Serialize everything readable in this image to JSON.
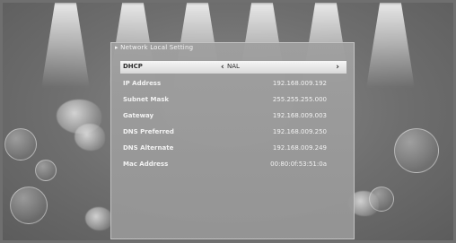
{
  "menu": {
    "title": "Network Local Setting"
  },
  "rows": [
    {
      "label": "DHCP",
      "value": "NAL"
    },
    {
      "label": "IP Address",
      "value": "192.168.009.192"
    },
    {
      "label": "Subnet Mask",
      "value": "255.255.255.000"
    },
    {
      "label": "Gateway",
      "value": "192.168.009.003"
    },
    {
      "label": "DNS Preferred",
      "value": "192.168.009.250"
    },
    {
      "label": "DNS Alternate",
      "value": "192.168.009.249"
    },
    {
      "label": "Mac Address",
      "value": "00:80:0f:53:51:0a"
    }
  ],
  "icons": {
    "left_arrow": "chevron-left-icon",
    "right_arrow": "chevron-right-icon"
  },
  "colors": {
    "background": "#6f6f6f",
    "panel": "#9c9c9c",
    "selected_row": "#ececec"
  }
}
